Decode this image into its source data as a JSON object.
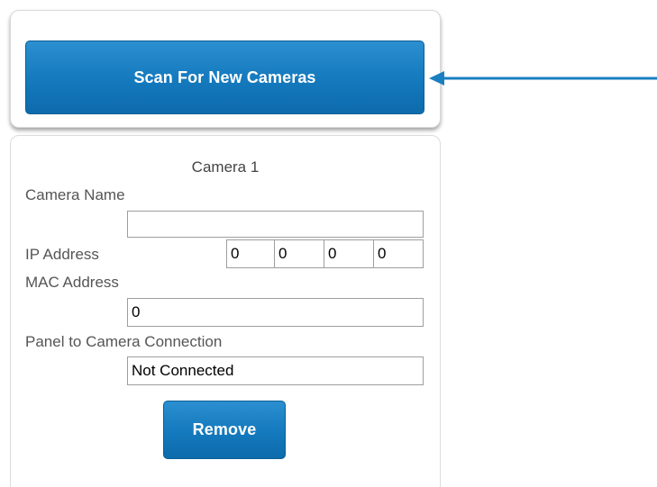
{
  "toolbar": {
    "scan_label": "Scan For New Cameras"
  },
  "camera": {
    "title": "Camera 1",
    "name_label": "Camera Name",
    "name_value": "",
    "ip_label": "IP Address",
    "ip_octets": [
      "0",
      "0",
      "0",
      "0"
    ],
    "mac_label": "MAC Address",
    "mac_value": "0",
    "connection_label": "Panel to Camera Connection",
    "connection_value": "Not Connected",
    "remove_label": "Remove"
  },
  "colors": {
    "accent": "#1479bd",
    "arrow": "#1a7fc1"
  }
}
